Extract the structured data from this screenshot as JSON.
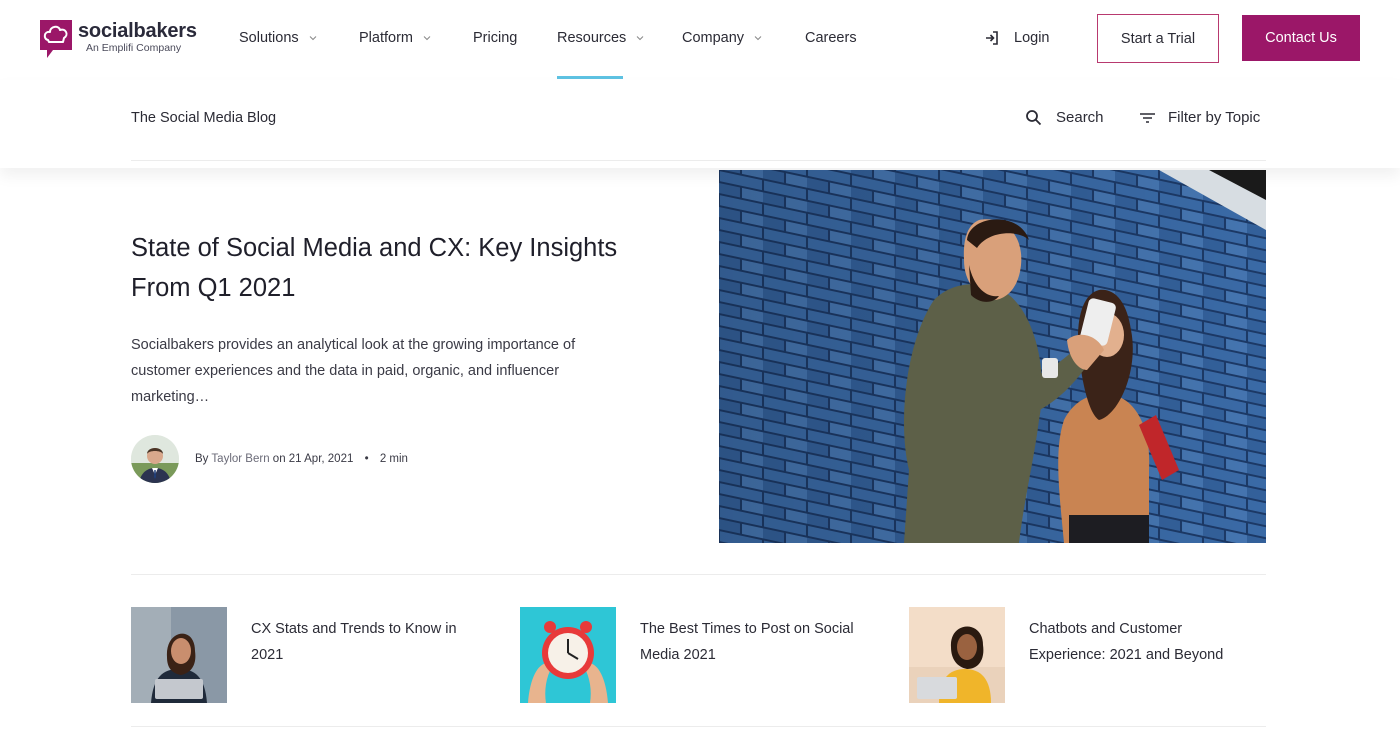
{
  "brand": {
    "name": "socialbakers",
    "tagline": "An Emplifi Company",
    "color": "#9b1768"
  },
  "nav": {
    "items": [
      {
        "label": "Solutions",
        "has_dropdown": true
      },
      {
        "label": "Platform",
        "has_dropdown": true
      },
      {
        "label": "Pricing",
        "has_dropdown": false
      },
      {
        "label": "Resources",
        "has_dropdown": true,
        "active": true
      },
      {
        "label": "Company",
        "has_dropdown": true
      },
      {
        "label": "Careers",
        "has_dropdown": false
      }
    ],
    "login_label": "Login",
    "trial_label": "Start a Trial",
    "contact_label": "Contact Us",
    "active_underline_color": "#5ec2e2"
  },
  "subnav": {
    "blog_title": "The Social Media Blog",
    "search_label": "Search",
    "filter_label": "Filter by Topic"
  },
  "featured": {
    "title": "State of Social Media and CX: Key Insights From Q1 2021",
    "excerpt": "Socialbakers provides an analytical look at the growing importance of customer experiences and the data in paid, organic, and influencer marketing…",
    "by": "By",
    "author": "Taylor Bern",
    "on": "on 21 Apr, 2021",
    "separator": "•",
    "read_time": "2 min"
  },
  "related": [
    {
      "title": "CX Stats and Trends to Know in 2021"
    },
    {
      "title": "The Best Times to Post on Social Media 2021"
    },
    {
      "title": "Chatbots and Customer Experience: 2021 and Beyond"
    }
  ]
}
